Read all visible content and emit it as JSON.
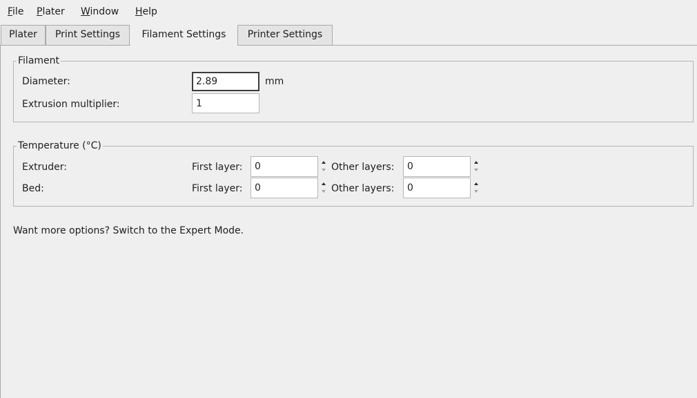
{
  "menubar": {
    "items": [
      {
        "mnemonic": "F",
        "rest": "ile"
      },
      {
        "mnemonic": "P",
        "rest": "later"
      },
      {
        "mnemonic": "W",
        "rest": "indow"
      },
      {
        "mnemonic": "H",
        "rest": "elp"
      }
    ]
  },
  "tabs": [
    {
      "label": "Plater",
      "active": false
    },
    {
      "label": "Print Settings",
      "active": false
    },
    {
      "label": "Filament Settings",
      "active": true
    },
    {
      "label": "Printer Settings",
      "active": false
    }
  ],
  "filament": {
    "title": "Filament",
    "diameter_label": "Diameter:",
    "diameter_value": "2.89",
    "diameter_unit": "mm",
    "extrusion_label": "Extrusion multiplier:",
    "extrusion_value": "1"
  },
  "temperature": {
    "title": "Temperature (°C)",
    "first_layer_label": "First layer:",
    "other_layers_label": "Other layers:",
    "extruder": {
      "label": "Extruder:",
      "first_layer_value": "0",
      "other_layers_value": "0"
    },
    "bed": {
      "label": "Bed:",
      "first_layer_value": "0",
      "other_layers_value": "0"
    }
  },
  "footer": {
    "expert_hint": "Want more options? Switch to the Expert Mode."
  },
  "colors": {
    "background": "#efefef",
    "border": "#b4b4b4",
    "field_background": "#ffffff",
    "text": "#1e1e1e"
  }
}
